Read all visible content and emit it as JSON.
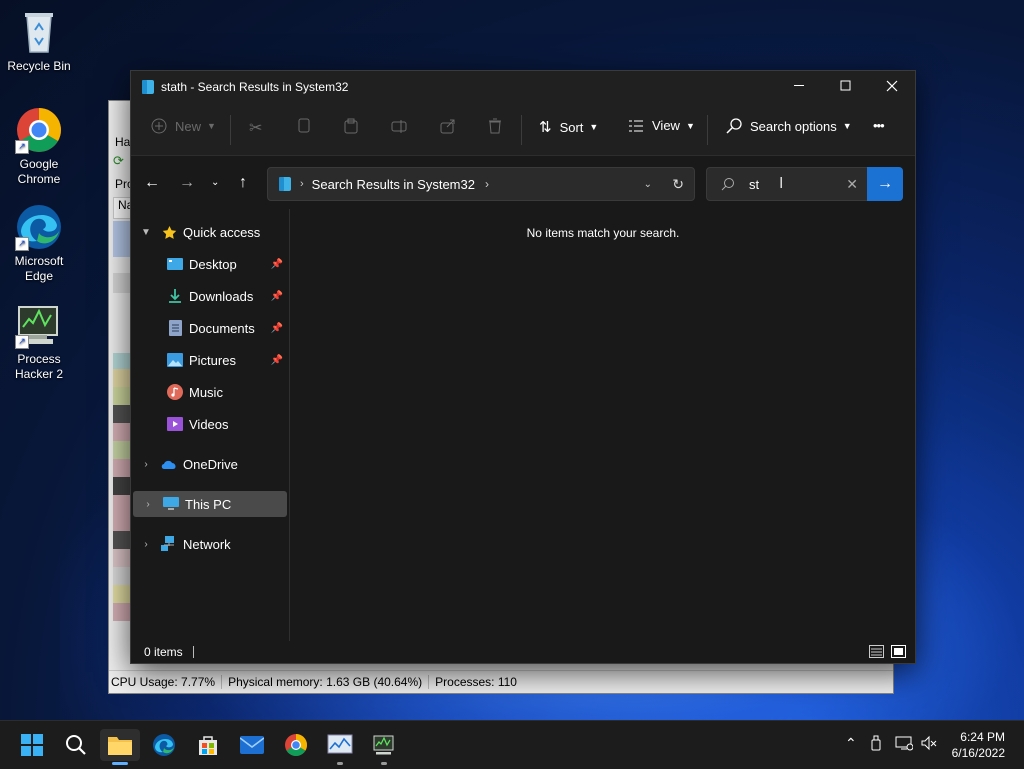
{
  "desktop": {
    "icons": [
      {
        "label": "Recycle Bin",
        "icon": "recycle-bin-icon"
      },
      {
        "label": "Google Chrome",
        "icon": "chrome-icon"
      },
      {
        "label": "Microsoft Edge",
        "icon": "edge-icon"
      },
      {
        "label": "Process Hacker 2",
        "icon": "process-hacker-icon"
      }
    ]
  },
  "process_hacker": {
    "menu_hint": "Ha",
    "tab_hint": "Pro",
    "col_hint": "Na",
    "status": {
      "cpu": "CPU Usage: 7.77%",
      "memory": "Physical memory: 1.63 GB (40.64%)",
      "processes": "Processes: 110"
    }
  },
  "explorer": {
    "title": "stath - Search Results in System32",
    "toolbar": {
      "new_label": "New",
      "sort_label": "Sort",
      "view_label": "View",
      "search_options_label": "Search options",
      "more_label": "•••"
    },
    "address": {
      "path": "Search Results in System32"
    },
    "search": {
      "value": "st"
    },
    "nav": {
      "quick_access": "Quick access",
      "items": [
        {
          "label": "Desktop"
        },
        {
          "label": "Downloads"
        },
        {
          "label": "Documents"
        },
        {
          "label": "Pictures"
        },
        {
          "label": "Music"
        },
        {
          "label": "Videos"
        }
      ],
      "onedrive": "OneDrive",
      "this_pc": "This PC",
      "network": "Network"
    },
    "content": {
      "empty_message": "No items match your search."
    },
    "status": {
      "items_count": "0 items"
    }
  },
  "taskbar": {
    "clock_time": "6:24 PM",
    "clock_date": "6/16/2022"
  },
  "colors": {
    "accent": "#1c72d3",
    "explorer_bg": "#191919",
    "titlebar_bg": "#202020",
    "taskbar_bg": "#1c1c1c"
  }
}
